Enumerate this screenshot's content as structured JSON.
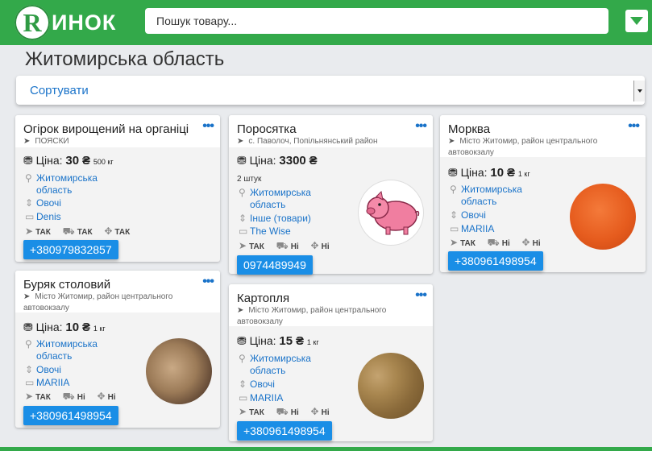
{
  "header": {
    "logo_letter": "R",
    "logo_text": "ИНОК",
    "search_placeholder": "Пошук товару..."
  },
  "page": {
    "title": "Житомирська область",
    "sort_label": "Сортувати"
  },
  "cards": [
    {
      "title": "Огірок вирощений на органіці",
      "location": "ПОЯСКИ",
      "price_label": "Ціна:",
      "price": "30",
      "currency": "₴",
      "unit": "500 кг",
      "region": "Житомирська область",
      "category": "Овочі",
      "seller": "Denis",
      "flags": [
        "ТАК",
        "ТАК",
        "ТАК"
      ],
      "phone": "+380979832857"
    },
    {
      "title": "Поросятка",
      "location": "с. Паволоч, Попільнянський район",
      "price_label": "Ціна:",
      "price": "3300",
      "currency": "₴",
      "quantity": "2 штук",
      "region": "Житомирська область",
      "category": "Інше (товари)",
      "seller": "The Wise",
      "flags": [
        "ТАК",
        "Ні",
        "Ні"
      ],
      "phone": "0974489949"
    },
    {
      "title": "Морква",
      "location": "Місто Житомир, район центрального автовокзалу",
      "price_label": "Ціна:",
      "price": "10",
      "currency": "₴",
      "unit": "1 кг",
      "region": "Житомирська область",
      "category": "Овочі",
      "seller": "MARIIA",
      "flags": [
        "ТАК",
        "Ні",
        "Ні"
      ],
      "phone": "+380961498954"
    },
    {
      "title": "Буряк столовий",
      "location": "Місто Житомир, район центрального автовокзалу",
      "price_label": "Ціна:",
      "price": "10",
      "currency": "₴",
      "unit": "1 кг",
      "region": "Житомирська область",
      "category": "Овочі",
      "seller": "MARIIA",
      "flags": [
        "ТАК",
        "Ні",
        "Ні"
      ],
      "phone": "+380961498954"
    },
    {
      "title": "Картопля",
      "location": "Місто Житомир, район центрального автовокзалу",
      "price_label": "Ціна:",
      "price": "15",
      "currency": "₴",
      "unit": "1 кг",
      "region": "Житомирська область",
      "category": "Овочі",
      "seller": "MARIIA",
      "flags": [
        "ТАК",
        "Ні",
        "Ні"
      ],
      "phone": "+380961498954"
    }
  ],
  "colors": {
    "brand_green": "#33a94a",
    "link_blue": "#1a73c9",
    "phone_blue": "#1a8ee6"
  },
  "icons": [
    "location-arrow-icon",
    "coins-icon",
    "map-marker-icon",
    "sort-icon",
    "store-icon",
    "truck-icon",
    "arrows-icon",
    "chevron-down-icon"
  ]
}
